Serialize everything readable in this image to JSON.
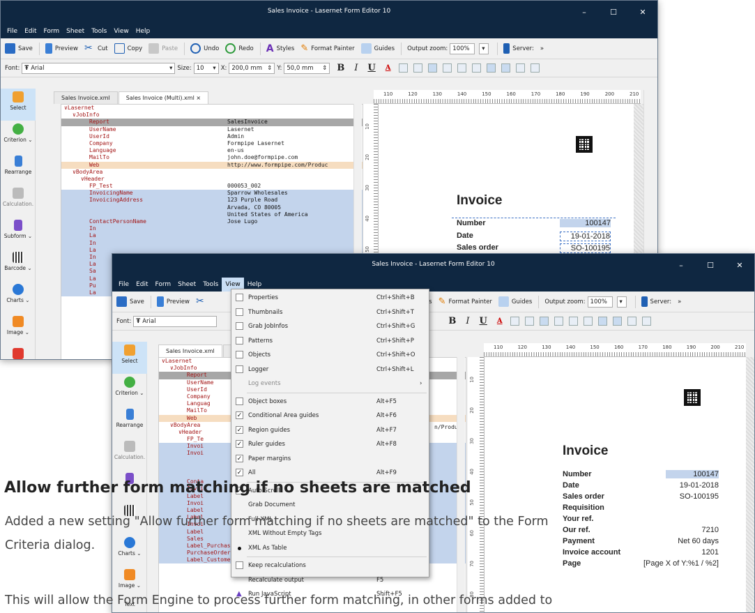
{
  "window1": {
    "title": "Sales Invoice - Lasernet Form Editor 10",
    "menu": [
      "File",
      "Edit",
      "Form",
      "Sheet",
      "Tools",
      "View",
      "Help"
    ]
  },
  "window2": {
    "title": "Sales Invoice - Lasernet Form Editor 10",
    "menu": [
      "File",
      "Edit",
      "Form",
      "Sheet",
      "Tools",
      "View",
      "Help"
    ]
  },
  "toolbar": {
    "save": "Save",
    "preview": "Preview",
    "cut": "Cut",
    "copy": "Copy",
    "paste": "Paste",
    "undo": "Undo",
    "redo": "Redo",
    "styles": "Styles",
    "format_painter": "Format Painter",
    "guides": "Guides",
    "output_zoom_label": "Output zoom:",
    "output_zoom_value": "100%",
    "server": "Server:",
    "more": "»"
  },
  "formatbar": {
    "font_label": "Font:",
    "font_value": "Arial",
    "size_label": "Size:",
    "size_value": "10",
    "x_label": "X:",
    "x_value": "200,0 mm",
    "y_label": "Y:",
    "y_value": "50,0 mm",
    "bold": "B",
    "italic": "I",
    "underline": "U",
    "color": "A"
  },
  "tools": [
    "Select",
    "Criterion",
    "Rearrange",
    "Calculation",
    "Subform",
    "Barcode",
    "Charts",
    "Image",
    "Text"
  ],
  "tabs": [
    "Sales Invoice.xml",
    "Sales Invoice (Multi).xml ×"
  ],
  "tabs2": [
    "Sales Invoice.xml",
    "S"
  ],
  "tree1": [
    {
      "k": "∨Lasernet",
      "v": "",
      "i": 0,
      "c": ""
    },
    {
      "k": "∨JobInfo",
      "v": "",
      "i": 1,
      "c": ""
    },
    {
      "k": "Report",
      "v": "SalesInvoice",
      "i": 3,
      "c": "g"
    },
    {
      "k": "UserName",
      "v": "Lasernet",
      "i": 3,
      "c": ""
    },
    {
      "k": "UserId",
      "v": "Admin",
      "i": 3,
      "c": ""
    },
    {
      "k": "Company",
      "v": "Formpipe Lasernet",
      "i": 3,
      "c": ""
    },
    {
      "k": "Language",
      "v": "en-us",
      "i": 3,
      "c": ""
    },
    {
      "k": "MailTo",
      "v": "john.doe@formpipe.com",
      "i": 3,
      "c": ""
    },
    {
      "k": "Web",
      "v": "http://www.formpipe.com/Produc",
      "i": 3,
      "c": "o"
    },
    {
      "k": "∨BodyArea",
      "v": "",
      "i": 1,
      "c": ""
    },
    {
      "k": "∨Header",
      "v": "",
      "i": 2,
      "c": ""
    },
    {
      "k": "FP_Test",
      "v": "000053_002",
      "i": 3,
      "c": ""
    },
    {
      "k": "InvoicingName",
      "v": "Sparrow Wholesales",
      "i": 3,
      "c": "b"
    },
    {
      "k": "InvoicingAddress",
      "v": "123 Purple Road",
      "i": 3,
      "c": "b"
    },
    {
      "k": "",
      "v": "Arvada, CO 80005",
      "i": 3,
      "c": "b"
    },
    {
      "k": "",
      "v": "United States of America",
      "i": 3,
      "c": "b"
    },
    {
      "k": "ContactPersonName",
      "v": "Jose Lugo",
      "i": 3,
      "c": "b"
    },
    {
      "k": "In",
      "v": "",
      "i": 3,
      "c": "b"
    },
    {
      "k": "La",
      "v": "",
      "i": 3,
      "c": "b"
    },
    {
      "k": "In",
      "v": "",
      "i": 3,
      "c": "b"
    },
    {
      "k": "La",
      "v": "",
      "i": 3,
      "c": "b"
    },
    {
      "k": "In",
      "v": "",
      "i": 3,
      "c": "b"
    },
    {
      "k": "La",
      "v": "",
      "i": 3,
      "c": "b"
    },
    {
      "k": "Sa",
      "v": "",
      "i": 3,
      "c": "b"
    },
    {
      "k": "La",
      "v": "",
      "i": 3,
      "c": "b"
    },
    {
      "k": "Pu",
      "v": "",
      "i": 3,
      "c": "b"
    },
    {
      "k": "La",
      "v": "",
      "i": 3,
      "c": "b"
    }
  ],
  "tree2": [
    {
      "k": "∨Lasernet",
      "v": "",
      "i": 0,
      "c": ""
    },
    {
      "k": "∨JobInfo",
      "v": "",
      "i": 1,
      "c": ""
    },
    {
      "k": "Report",
      "v": "",
      "i": 3,
      "c": "g"
    },
    {
      "k": "UserName",
      "v": "",
      "i": 3,
      "c": ""
    },
    {
      "k": "UserId",
      "v": "",
      "i": 3,
      "c": ""
    },
    {
      "k": "Company",
      "v": "",
      "i": 3,
      "c": ""
    },
    {
      "k": "Languag",
      "v": "",
      "i": 3,
      "c": ""
    },
    {
      "k": "MailTo",
      "v": "",
      "i": 3,
      "c": ""
    },
    {
      "k": "Web",
      "v": "",
      "i": 3,
      "c": "o"
    },
    {
      "k": "∨BodyArea",
      "v": "",
      "i": 1,
      "c": ""
    },
    {
      "k": "∨Header",
      "v": "",
      "i": 2,
      "c": ""
    },
    {
      "k": "FP_Te",
      "v": "",
      "i": 3,
      "c": ""
    },
    {
      "k": "Invoi",
      "v": "",
      "i": 3,
      "c": "b"
    },
    {
      "k": "Invoi",
      "v": "",
      "i": 3,
      "c": "b"
    },
    {
      "k": "",
      "v": "",
      "i": 3,
      "c": "b"
    },
    {
      "k": "",
      "v": "",
      "i": 3,
      "c": "b"
    },
    {
      "k": "",
      "v": "",
      "i": 3,
      "c": "b"
    },
    {
      "k": "Conta",
      "v": "",
      "i": 3,
      "c": "b"
    },
    {
      "k": "Invoi",
      "v": "",
      "i": 3,
      "c": "b"
    },
    {
      "k": "Label",
      "v": "",
      "i": 3,
      "c": "b"
    },
    {
      "k": "Invoi",
      "v": "",
      "i": 3,
      "c": "b"
    },
    {
      "k": "Label",
      "v": "",
      "i": 3,
      "c": "b"
    },
    {
      "k": "Label",
      "v": "",
      "i": 3,
      "c": "b"
    },
    {
      "k": "Invoi",
      "v": "",
      "i": 3,
      "c": "b"
    },
    {
      "k": "Label",
      "v": "",
      "i": 3,
      "c": "b"
    },
    {
      "k": "Sales",
      "v": "",
      "i": 3,
      "c": "b"
    },
    {
      "k": "Label_PurchaseOrder",
      "v": "Requisition",
      "i": 3,
      "c": "b"
    },
    {
      "k": "PurchaseOrder",
      "v": "",
      "i": 3,
      "c": "b"
    },
    {
      "k": "Label_CustomerRef",
      "v": "Your ref.",
      "i": 3,
      "c": "b"
    }
  ],
  "tree2_web_tail": "n/Produc",
  "ruler_ticks": [
    "110",
    "120",
    "130",
    "140",
    "150",
    "160",
    "170",
    "180",
    "190",
    "200",
    "210"
  ],
  "vruler_ticks": [
    "10",
    "20",
    "30",
    "40",
    "50",
    "60",
    "70",
    "80"
  ],
  "invoice": {
    "title": "Invoice",
    "labels": [
      "Number",
      "Date",
      "Sales order",
      "Requisition",
      "Your ref.",
      "Our ref.",
      "Payment",
      "Invoice account",
      "Page"
    ],
    "values": [
      "100147",
      "19-01-2018",
      "SO-100195",
      "",
      "",
      "7210",
      "Net 60 days",
      "1201",
      "[Page X of Y:%1 / %2]"
    ]
  },
  "view_menu": [
    {
      "type": "item",
      "label": "Properties",
      "shortcut": "Ctrl+Shift+B",
      "check": "box"
    },
    {
      "type": "item",
      "label": "Thumbnails",
      "shortcut": "Ctrl+Shift+T",
      "check": "box"
    },
    {
      "type": "item",
      "label": "Grab JobInfos",
      "shortcut": "Ctrl+Shift+G",
      "check": "box"
    },
    {
      "type": "item",
      "label": "Patterns",
      "shortcut": "Ctrl+Shift+P",
      "check": "box"
    },
    {
      "type": "item",
      "label": "Objects",
      "shortcut": "Ctrl+Shift+O",
      "check": "box"
    },
    {
      "type": "item",
      "label": "Logger",
      "shortcut": "Ctrl+Shift+L",
      "check": "box"
    },
    {
      "type": "disabled",
      "label": "Log events",
      "shortcut": "›",
      "check": ""
    },
    {
      "type": "sep"
    },
    {
      "type": "item",
      "label": "Object boxes",
      "shortcut": "Alt+F5",
      "check": "box"
    },
    {
      "type": "item",
      "label": "Conditional Area guides",
      "shortcut": "Alt+F6",
      "check": "checked"
    },
    {
      "type": "item",
      "label": "Region guides",
      "shortcut": "Alt+F7",
      "check": "checked"
    },
    {
      "type": "item",
      "label": "Ruler guides",
      "shortcut": "Alt+F8",
      "check": "checked"
    },
    {
      "type": "item",
      "label": "Paper margins",
      "shortcut": "",
      "check": "checked"
    },
    {
      "type": "item",
      "label": "All",
      "shortcut": "Alt+F9",
      "check": "checked"
    },
    {
      "type": "sep"
    },
    {
      "type": "item",
      "label": "Auto Scroll",
      "shortcut": "",
      "check": "checked"
    },
    {
      "type": "item",
      "label": "Grab Document",
      "shortcut": "",
      "check": ""
    },
    {
      "type": "item",
      "label": "Full XML",
      "shortcut": "",
      "check": ""
    },
    {
      "type": "item",
      "label": "XML Without Empty Tags",
      "shortcut": "",
      "check": ""
    },
    {
      "type": "item",
      "label": "XML As Table",
      "shortcut": "",
      "check": "bullet"
    },
    {
      "type": "sep"
    },
    {
      "type": "item",
      "label": "Keep recalculations",
      "shortcut": "",
      "check": "box"
    },
    {
      "type": "item",
      "label": "Recalculate output",
      "shortcut": "F5",
      "check": ""
    },
    {
      "type": "item",
      "label": "Run JavaScript",
      "shortcut": "Shift+F5",
      "check": "js"
    }
  ],
  "article": {
    "heading": "Allow further form matching if no sheets are matched",
    "para1_line1": "Added a new setting \"Allow further form matching if no sheets are matched\" to the Form",
    "para1_line2": "Criteria dialog.",
    "para2_line1": "This will allow the Form Engine to process further form matching, in other forms added to"
  },
  "colors": {
    "titlebar": "#0f2741",
    "selection": "#c3d4ec",
    "highlight": "#a7a7a7",
    "accent": "#1e73c8"
  }
}
